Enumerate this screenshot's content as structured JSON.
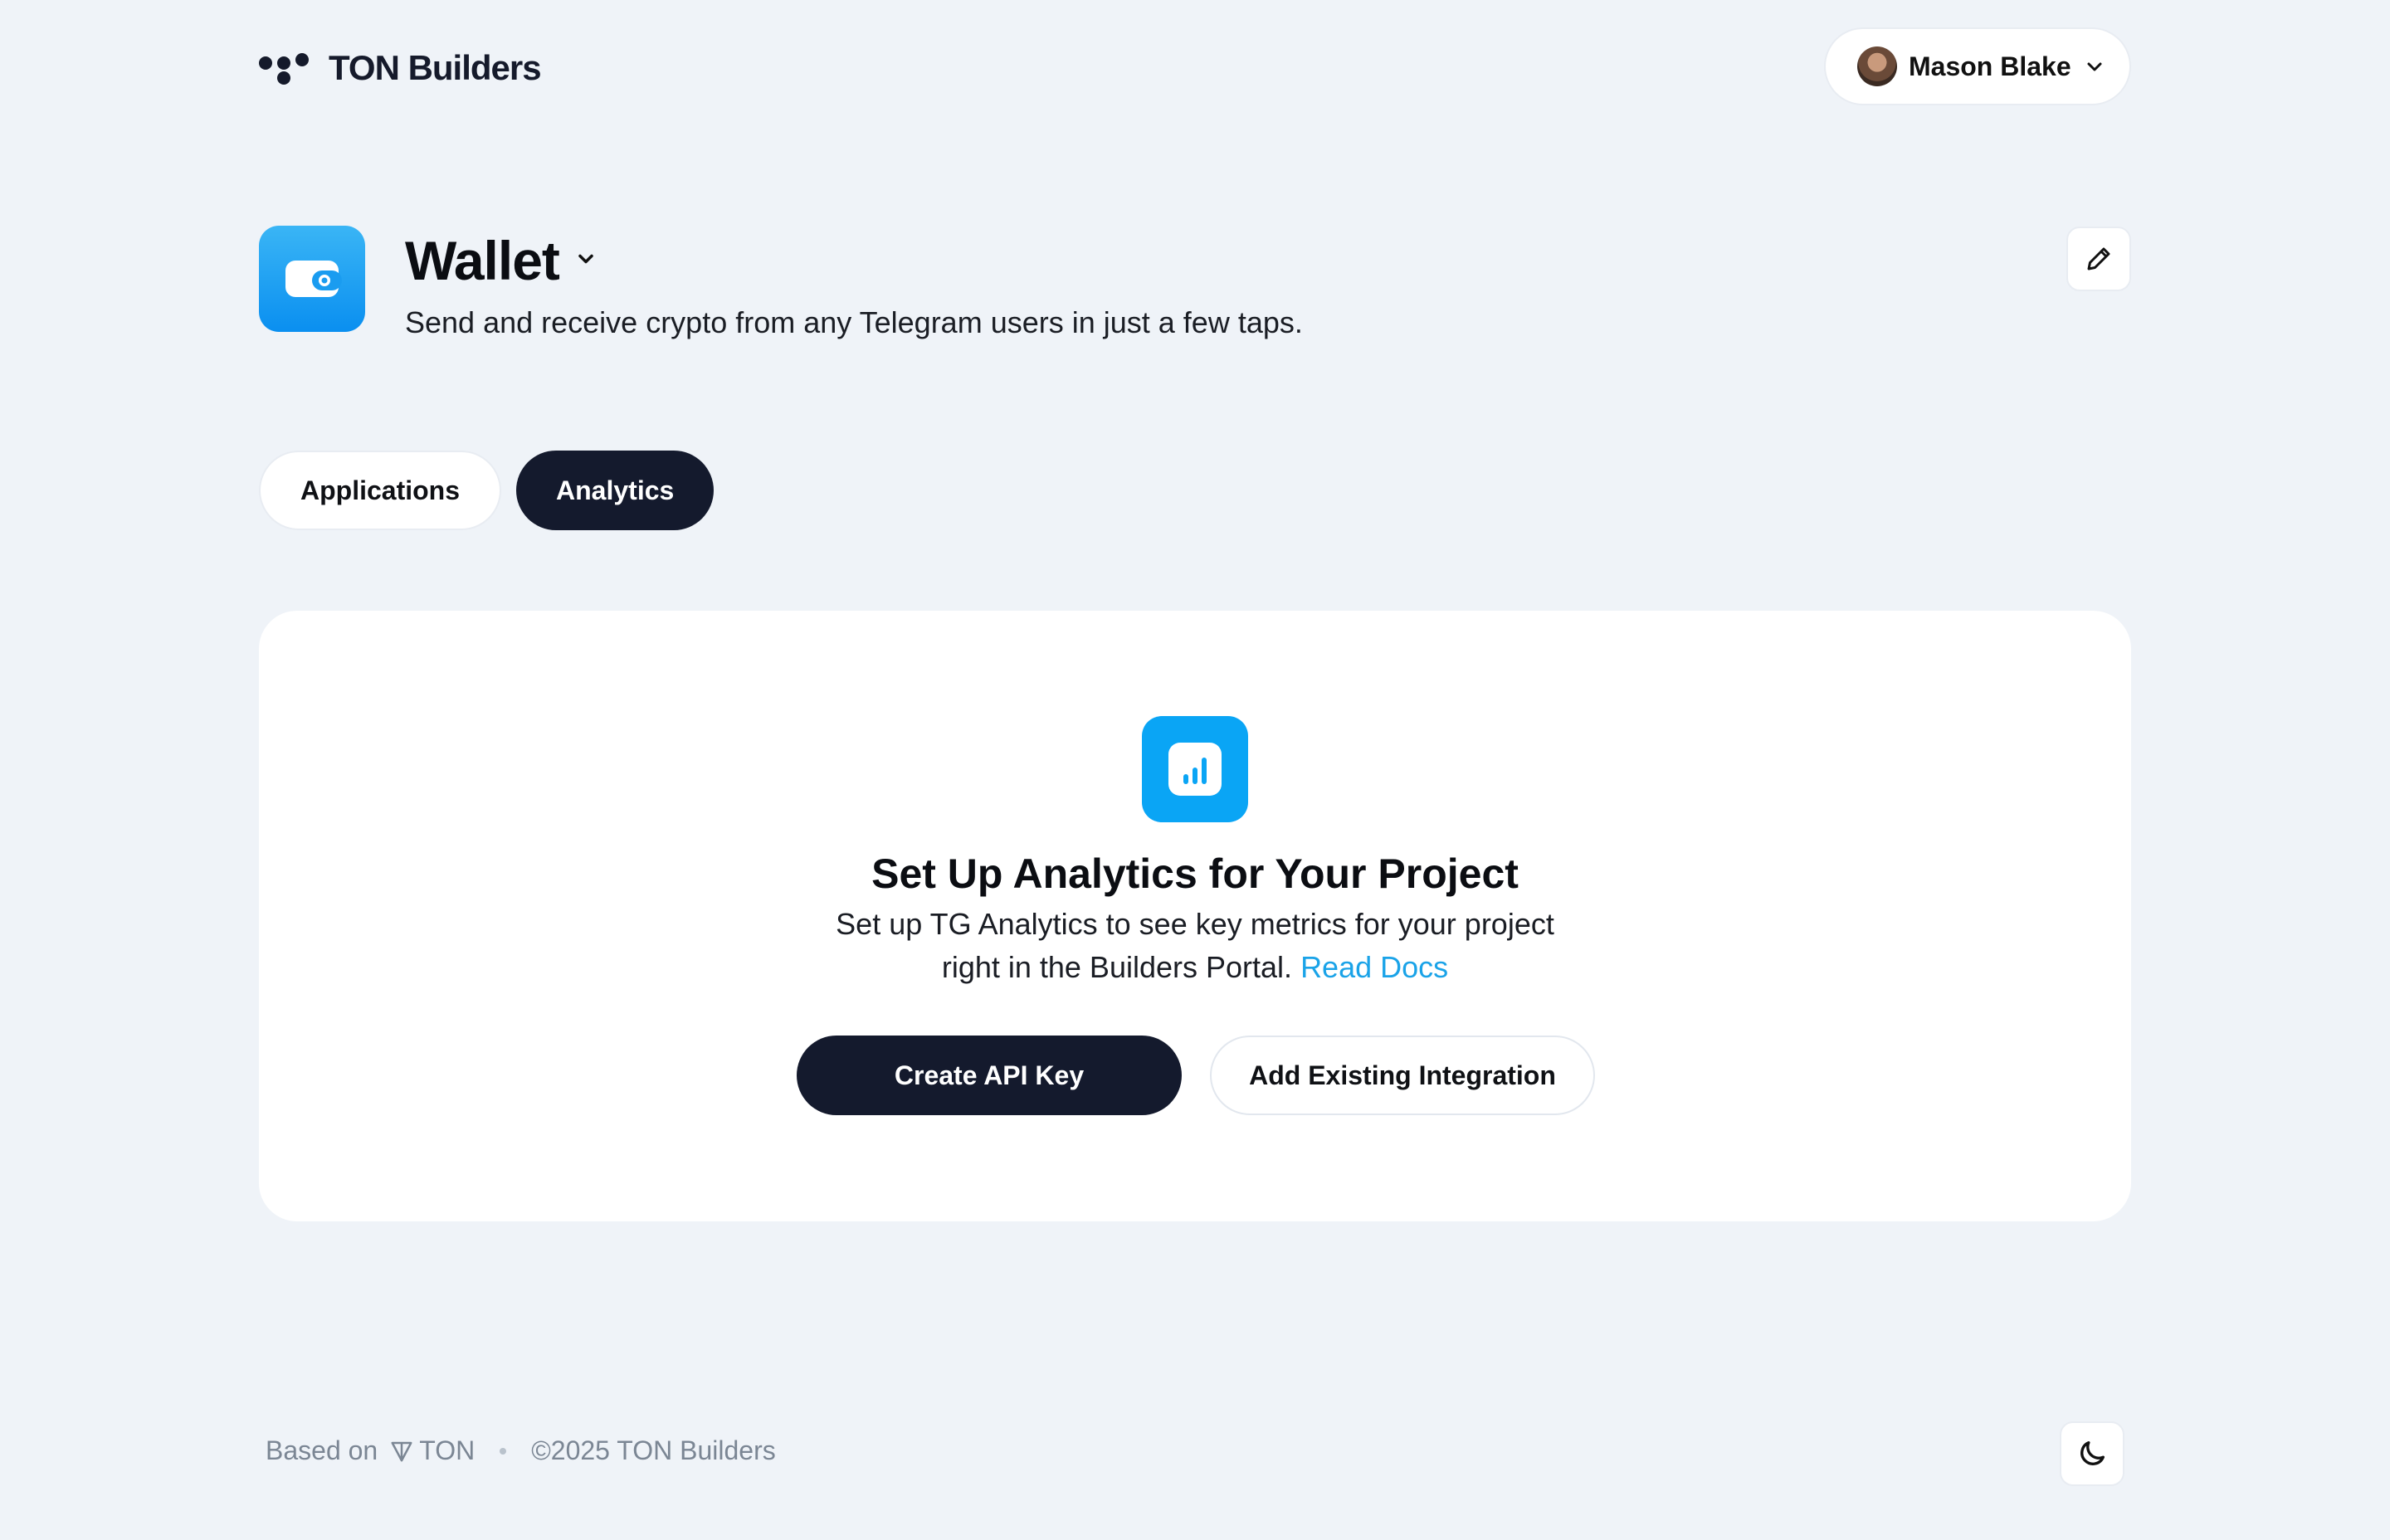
{
  "header": {
    "logo_text": "TON Builders",
    "user_name": "Mason Blake"
  },
  "project": {
    "name": "Wallet",
    "description": "Send and receive crypto from any Telegram users in just a few taps."
  },
  "tabs": [
    {
      "label": "Applications",
      "active": false
    },
    {
      "label": "Analytics",
      "active": true
    }
  ],
  "analytics_card": {
    "title": "Set Up Analytics for Your Project",
    "description_line1": "Set up TG Analytics to see key metrics for your project",
    "description_line2": "right in the Builders Portal.",
    "read_docs_link": "Read Docs",
    "primary_button": "Create API Key",
    "secondary_button": "Add Existing Integration"
  },
  "footer": {
    "based_on": "Based on",
    "ton_label": "TON",
    "copyright": "©2025 TON Builders"
  },
  "colors": {
    "background": "#eff3f8",
    "dark": "#141a2d",
    "accent_blue": "#0aa5f5",
    "link": "#1aa3e8"
  }
}
